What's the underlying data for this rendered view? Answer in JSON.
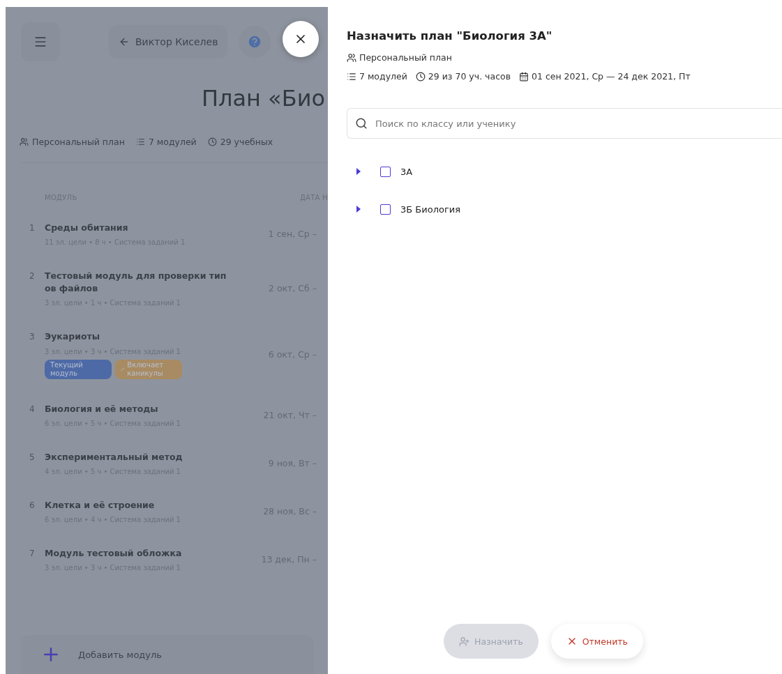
{
  "page": {
    "back_link": "Виктор Киселев",
    "title": "План «Био",
    "meta": [
      {
        "kind": "plan",
        "text": "Персональный план"
      },
      {
        "kind": "modules",
        "text": "7 модулей"
      },
      {
        "kind": "hours",
        "text": "29 учебных"
      }
    ],
    "columns": [
      "МОДУЛЬ",
      "ДАТА Н"
    ],
    "modules": [
      {
        "number": "1",
        "title": "Среды обитания",
        "details": "11 эл. цели • 8 ч • Система заданий 1",
        "date": "1 сен, Ср –"
      },
      {
        "number": "2",
        "title": "Тестовый модуль для проверки типов файлов",
        "details": "3 эл. цели • 1 ч • Система заданий 1",
        "date": "2 окт, Сб –"
      },
      {
        "number": "3",
        "title": "Эукариоты",
        "details": "3 эл. цели • 3 ч • Система заданий 1",
        "date": "6 окт, Ср –",
        "tags": [
          {
            "label": "Текущий модуль",
            "color": "#4e6aa6",
            "kind": "plain"
          },
          {
            "label": "Включает каникулы",
            "color": "#a88b62",
            "kind": "icon"
          }
        ]
      },
      {
        "number": "4",
        "title": "Биология и её методы",
        "details": "6 эл. цели • 5 ч • Система заданий 1",
        "date": "21 окт, Чт –"
      },
      {
        "number": "5",
        "title": "Экспериментальный метод",
        "details": "4 эл. цели • 5 ч • Система заданий 1",
        "date": "9 ноя, Вт –"
      },
      {
        "number": "6",
        "title": "Клетка и её строение",
        "details": "6 эл. цели • 4 ч • Система заданий 1",
        "date": "28 ноя, Вс –"
      },
      {
        "number": "7",
        "title": "Модуль тестовый обложка",
        "details": "3 эл. цели • 3 ч • Система заданий 1",
        "date": "13 дек, Пн –"
      }
    ],
    "add_button": "Добавить модуль"
  },
  "drawer": {
    "title": "Назначить план \"Биология 3А\"",
    "plan_type": "Персональный план",
    "meta": [
      {
        "kind": "modules",
        "text": "7 модулей"
      },
      {
        "kind": "hours",
        "text": "29 из 70 уч. часов"
      },
      {
        "kind": "dates",
        "text": "01 сен 2021, Ср — 24 дек 2021, Пт"
      }
    ],
    "search": {
      "placeholder": "Поиск по классу или ученику"
    },
    "tree": [
      {
        "label": "3А",
        "expanded": false,
        "checked": false
      },
      {
        "label": "3Б Биология",
        "expanded": false,
        "checked": false
      }
    ],
    "buttons": [
      {
        "kind": "assign",
        "label": "Назначить",
        "disabled": true
      },
      {
        "kind": "cancel",
        "label": "Отменить"
      }
    ]
  }
}
